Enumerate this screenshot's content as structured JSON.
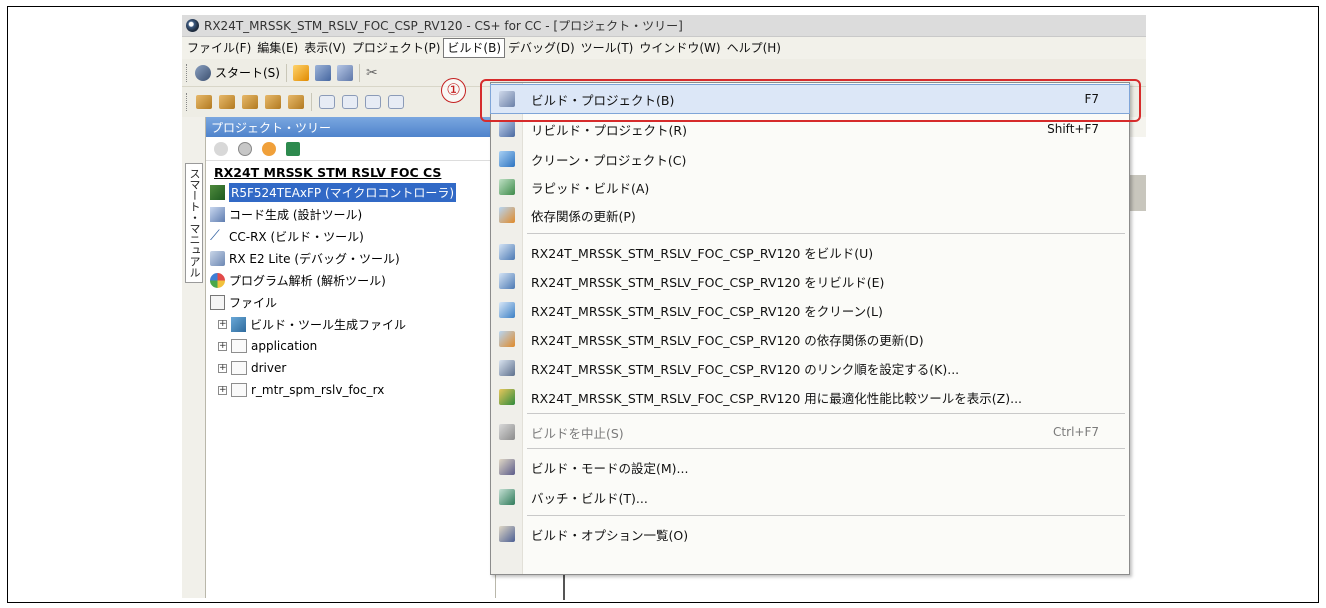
{
  "window": {
    "title": "RX24T_MRSSK_STM_RSLV_FOC_CSP_RV120 - CS+ for CC - [プロジェクト・ツリー]"
  },
  "menubar": {
    "items": [
      {
        "label": "ファイル(F)"
      },
      {
        "label": "編集(E)"
      },
      {
        "label": "表示(V)"
      },
      {
        "label": "プロジェクト(P)"
      },
      {
        "label": "ビルド(B)",
        "active": true
      },
      {
        "label": "デバッグ(D)"
      },
      {
        "label": "ツール(T)"
      },
      {
        "label": "ウインドウ(W)"
      },
      {
        "label": "ヘルプ(H)"
      }
    ]
  },
  "toolbar": {
    "start_label": "スタート(S)"
  },
  "side_tab": {
    "label": "スマート・マニュアル"
  },
  "project_tree": {
    "header": "プロジェクト・ツリー",
    "root": "RX24T MRSSK STM RSLV FOC CS",
    "items": [
      {
        "label": "R5F524TEAxFP (マイクロコントローラ)",
        "icon": "chip-icon",
        "selected": true
      },
      {
        "label": "コード生成 (設計ツール)",
        "icon": "code-generator-icon"
      },
      {
        "label": "CC-RX (ビルド・ツール)",
        "icon": "build-tool-icon"
      },
      {
        "label": "RX E2 Lite (デバッグ・ツール)",
        "icon": "debug-tool-icon"
      },
      {
        "label": "プログラム解析 (解析ツール)",
        "icon": "analysis-tool-icon"
      },
      {
        "label": "ファイル",
        "icon": "file-icon"
      }
    ],
    "folders": [
      {
        "label": "ビルド・ツール生成ファイル"
      },
      {
        "label": "application"
      },
      {
        "label": "driver"
      },
      {
        "label": "r_mtr_spm_rslv_foc_rx"
      }
    ]
  },
  "build_menu": {
    "items": [
      {
        "label": "ビルド・プロジェクト(B)",
        "shortcut": "F7",
        "icon": "build-project-icon",
        "highlighted": true
      },
      {
        "label": "リビルド・プロジェクト(R)",
        "shortcut": "Shift+F7",
        "icon": "rebuild-project-icon"
      },
      {
        "label": "クリーン・プロジェクト(C)",
        "shortcut": "",
        "icon": "clean-project-icon"
      },
      {
        "label": "ラピッド・ビルド(A)",
        "shortcut": "",
        "icon": "rapid-build-icon"
      },
      {
        "label": "依存関係の更新(P)",
        "shortcut": "",
        "icon": "update-dependencies-icon"
      },
      {
        "label": "RX24T_MRSSK_STM_RSLV_FOC_CSP_RV120 をビルド(U)",
        "shortcut": "",
        "icon": "build-icon"
      },
      {
        "label": "RX24T_MRSSK_STM_RSLV_FOC_CSP_RV120 をリビルド(E)",
        "shortcut": "",
        "icon": "rebuild-icon"
      },
      {
        "label": "RX24T_MRSSK_STM_RSLV_FOC_CSP_RV120 をクリーン(L)",
        "shortcut": "",
        "icon": "clean-icon"
      },
      {
        "label": "RX24T_MRSSK_STM_RSLV_FOC_CSP_RV120 の依存関係の更新(D)",
        "shortcut": "",
        "icon": "dependencies-icon"
      },
      {
        "label": "RX24T_MRSSK_STM_RSLV_FOC_CSP_RV120 のリンク順を設定する(K)...",
        "shortcut": "",
        "icon": "link-order-icon"
      },
      {
        "label": "RX24T_MRSSK_STM_RSLV_FOC_CSP_RV120 用に最適化性能比較ツールを表示(Z)...",
        "shortcut": "",
        "icon": "optimization-chart-icon"
      },
      {
        "label": "ビルドを中止(S)",
        "shortcut": "Ctrl+F7",
        "icon": "stop-build-icon",
        "disabled": true
      },
      {
        "label": "ビルド・モードの設定(M)...",
        "shortcut": "",
        "icon": "build-mode-icon"
      },
      {
        "label": "バッチ・ビルド(T)...",
        "shortcut": "",
        "icon": "batch-build-icon"
      },
      {
        "label": "ビルド・オプション一覧(O)",
        "shortcut": "",
        "icon": "build-options-icon"
      }
    ]
  },
  "annotation": {
    "callout_number": "①",
    "highlight_color": "#d62b2b"
  }
}
